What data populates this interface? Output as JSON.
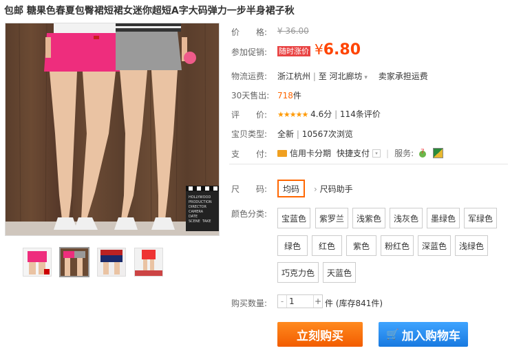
{
  "title": "包邮 糖果色春夏包臀裙短裙女迷你超短A字大码弹力一步半身裙子秋",
  "price": {
    "label": "价　　格:",
    "original": "¥ 36.00"
  },
  "promo": {
    "label": "参加促销:",
    "tag": "随时涨价",
    "currency": "¥",
    "amount": "6.80"
  },
  "shipping": {
    "label": "物流运费:",
    "from": "浙江杭州",
    "sep": "至",
    "to": "河北廊坊",
    "note": "卖家承担运费"
  },
  "sales": {
    "label": "30天售出:",
    "count": "718",
    "unit": "件"
  },
  "rating": {
    "label": "评　　价:",
    "stars": "★★★★★",
    "score": "4.6分",
    "reviews": "114条评价"
  },
  "type": {
    "label": "宝贝类型:",
    "condition": "全新",
    "views": "10567次浏览"
  },
  "payment": {
    "label": "支　　付:",
    "card": "信用卡分期",
    "quick": "快捷支付",
    "service_label": "服务:"
  },
  "size": {
    "label": "尺　　码:",
    "selected": "均码",
    "helper": "尺码助手"
  },
  "colors": {
    "label": "颜色分类:",
    "options": [
      "宝蓝色",
      "紫罗兰",
      "浅紫色",
      "浅灰色",
      "墨绿色",
      "军绿色",
      "绿色",
      "红色",
      "紫色",
      "粉红色",
      "深蓝色",
      "浅绿色",
      "巧克力色",
      "天蓝色"
    ]
  },
  "quantity": {
    "label": "购买数量:",
    "minus": "-",
    "value": "1",
    "plus": "+",
    "stock": "件 (库存841件)"
  },
  "buttons": {
    "buy": "立刻购买",
    "cart": "加入购物车"
  },
  "clapper": {
    "lines": [
      "HOLLYWOOD",
      "PRODUCTION",
      "DIRECTOR",
      "CAMERA",
      "DATE",
      "SCENE",
      "TAKE"
    ]
  }
}
